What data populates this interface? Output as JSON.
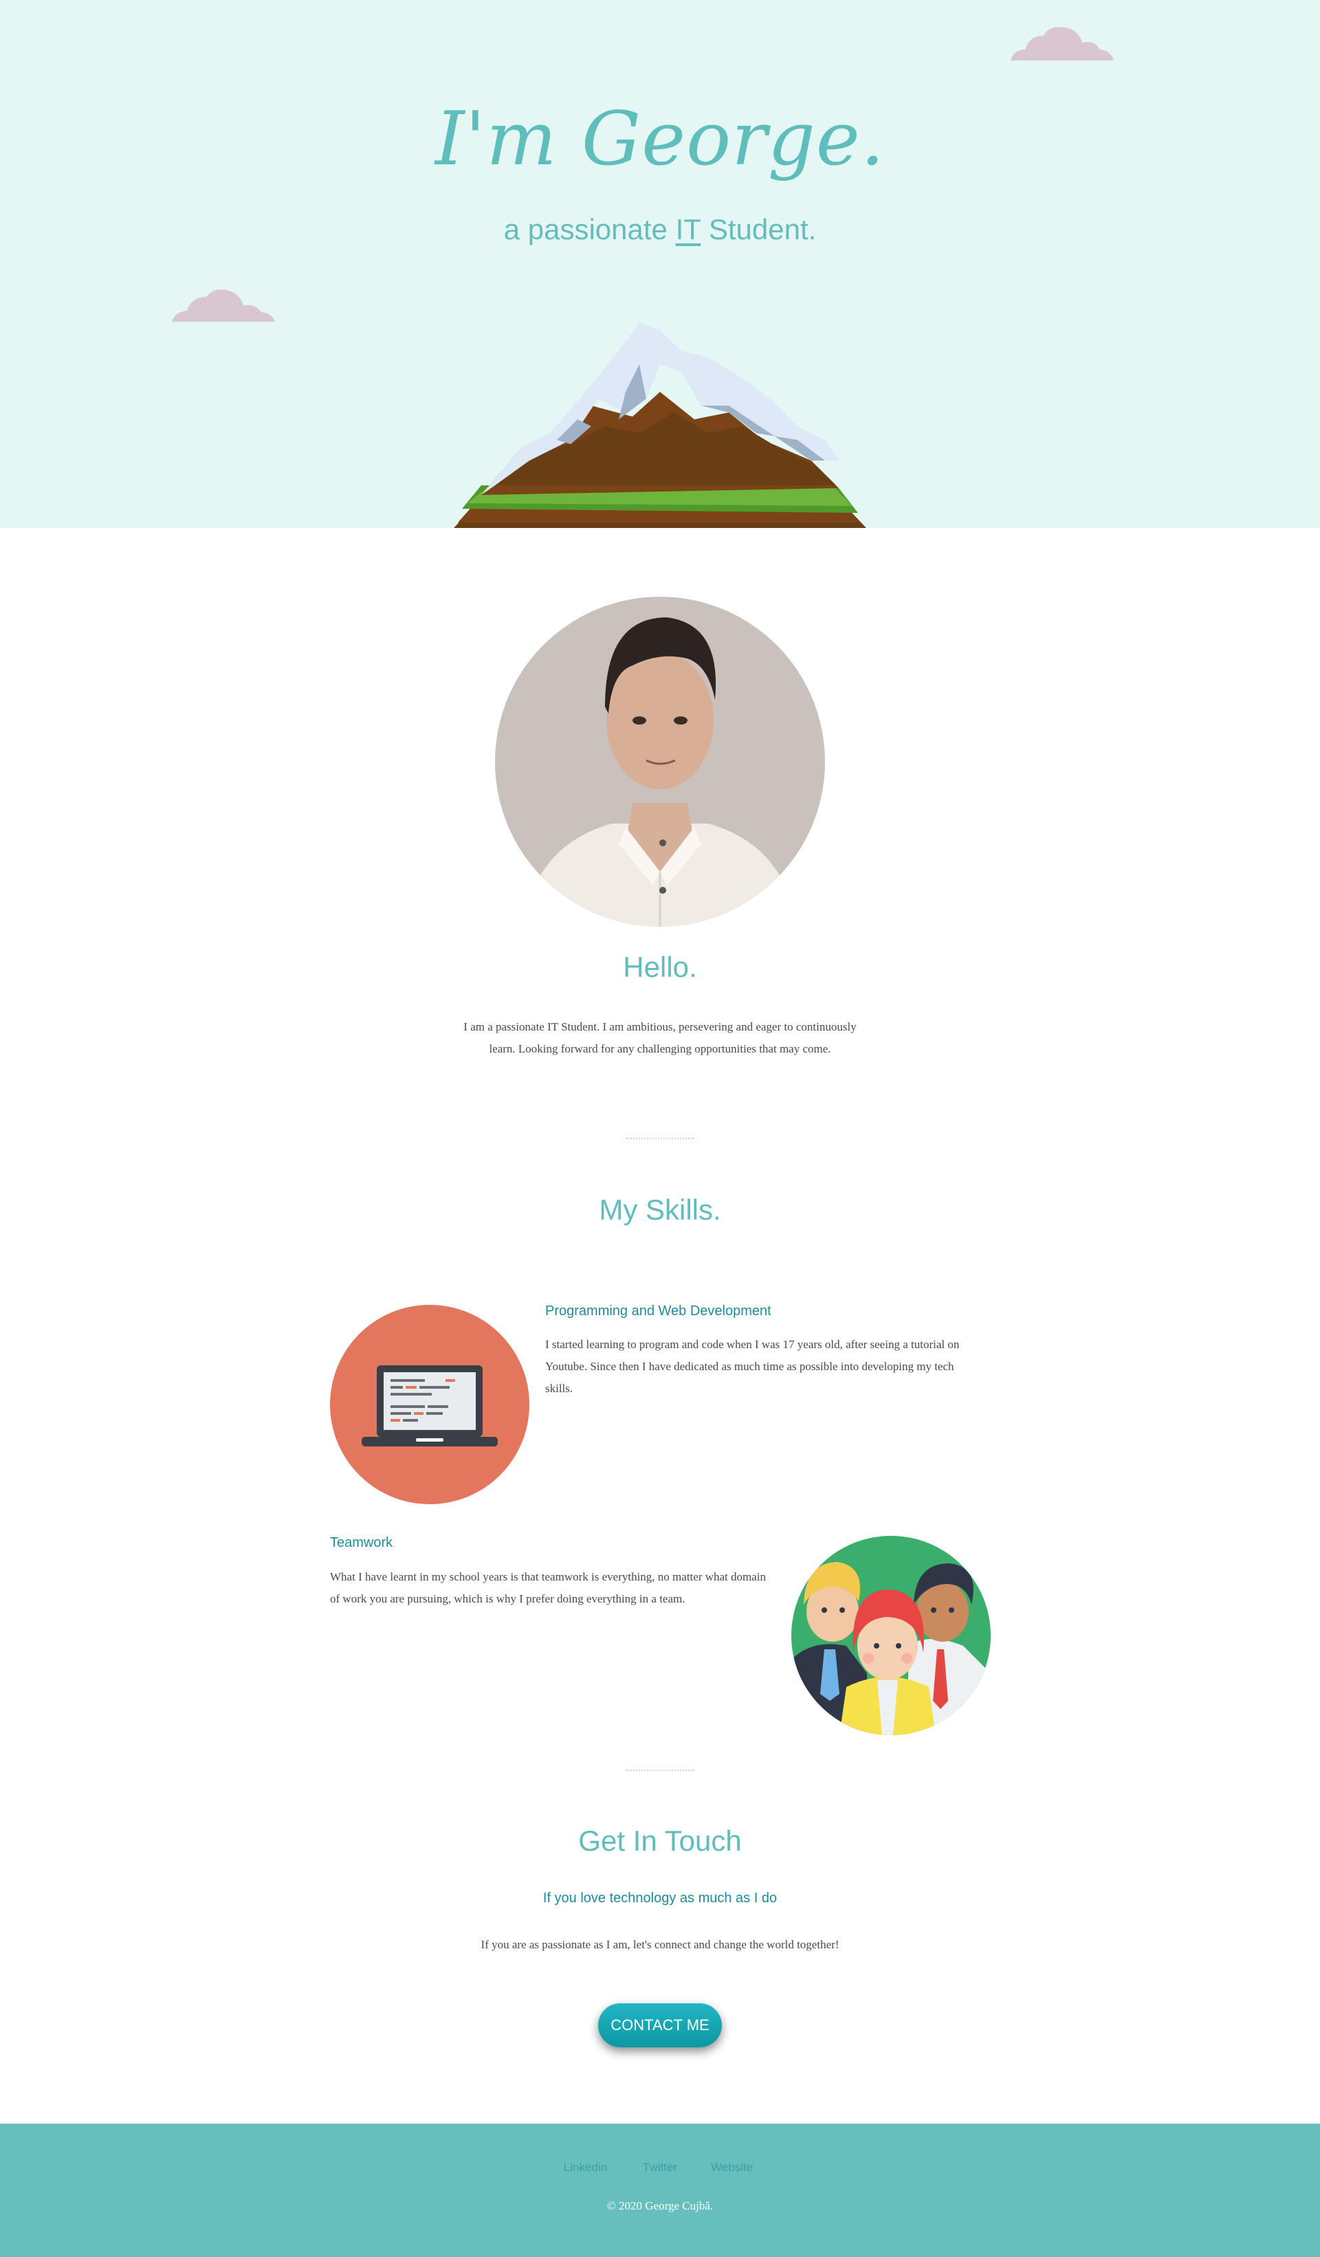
{
  "hero": {
    "title": "I'm George.",
    "subtitle_prefix": "a passionate ",
    "subtitle_highlight": "IT",
    "subtitle_suffix": " Student."
  },
  "about": {
    "heading": "Hello.",
    "text": "I am a passionate IT Student. I am ambitious, persevering and eager to continuously learn. Looking forward for any challenging opportunities that may come."
  },
  "skills": {
    "heading": "My Skills.",
    "items": [
      {
        "title": "Programming and Web Development",
        "text": "I started learning to program and code when I was 17 years old, after seeing a tutorial on Youtube. Since then I have dedicated as much time as possible into developing my tech skills."
      },
      {
        "title": "Teamwork",
        "text": "What I have learnt in my school years is that teamwork is everything, no matter what domain of work you are pursuing, which is why I prefer doing everything in a team."
      }
    ]
  },
  "contact": {
    "heading": "Get In Touch",
    "subheading": "If you love technology as much as I do",
    "text": "If you are as passionate as I am, let's connect and change the world together!",
    "button_label": "CONTACT ME"
  },
  "footer": {
    "links": [
      "Linkedin",
      "Twitter",
      "Website"
    ],
    "copyright": "© 2020 George Cujbă."
  },
  "colors": {
    "hero_bg": "#e4f7f5",
    "accent": "#5fbdbc",
    "skill_heading": "#1b8c98",
    "button": "#13a8b4",
    "footer_bg": "#67bfbd",
    "cloud": "#d9c6cf"
  },
  "icons": [
    "cloud-icon",
    "mountain-illustration",
    "laptop-icon",
    "team-icon"
  ]
}
